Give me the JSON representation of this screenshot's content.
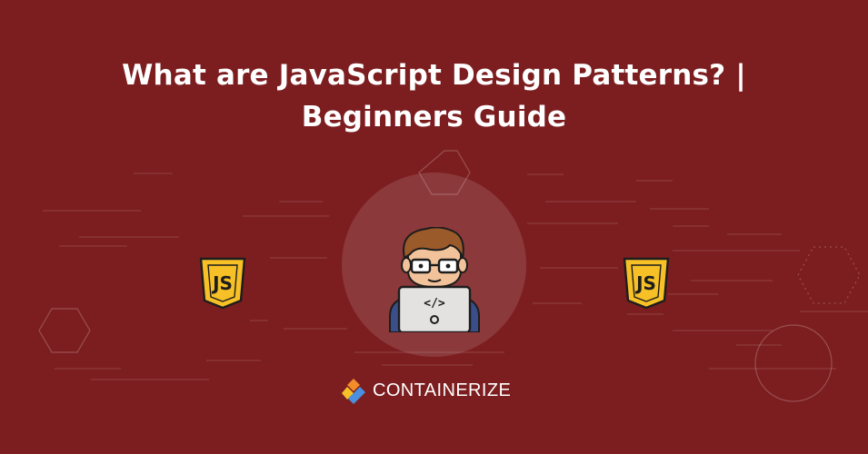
{
  "title": {
    "line1": "What are JavaScript Design Patterns? |",
    "line2": "Beginners Guide"
  },
  "badges": [
    {
      "icon": "javascript-icon",
      "label": "JS"
    },
    {
      "icon": "javascript-icon",
      "label": "JS"
    }
  ],
  "illustration": {
    "icon": "developer-laptop-icon",
    "code_glyph": "</>"
  },
  "brand": {
    "icon": "containerize-logo-icon",
    "name": "CONTAINERIZE"
  },
  "colors": {
    "background": "#7c1e20",
    "text": "#ffffff",
    "js_yellow": "#f6c026",
    "hair": "#9b5a2a",
    "skin": "#f2c39a",
    "laptop": "#e4e2e0",
    "logo_orange": "#f28c28",
    "logo_blue": "#4a8fe0"
  }
}
